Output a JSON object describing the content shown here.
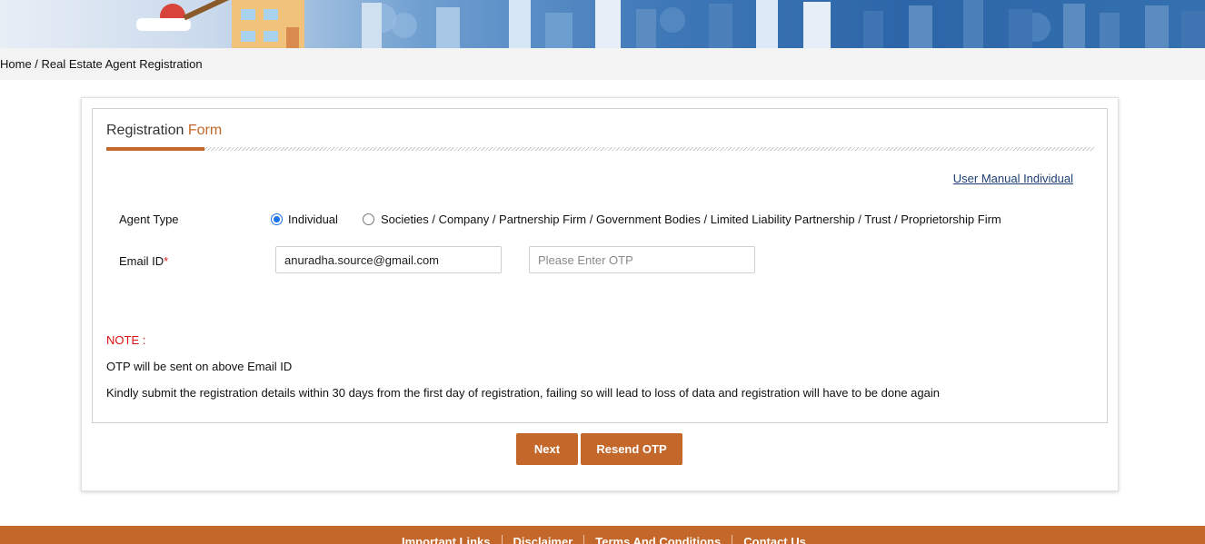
{
  "breadcrumb": {
    "home": "Home",
    "separator": " / ",
    "current": "Real Estate Agent Registration"
  },
  "form": {
    "title_main": "Registration",
    "title_accent": "Form",
    "manual_link": "User Manual Individual",
    "agent_type_label": "Agent Type",
    "agent_type_options": [
      {
        "label": "Individual",
        "selected": true
      },
      {
        "label": "Societies / Company / Partnership Firm / Government Bodies / Limited Liability Partnership / Trust / Proprietorship Firm",
        "selected": false
      }
    ],
    "email_label": "Email ID",
    "required_mark": "*",
    "email_value": "anuradha.source@gmail.com",
    "otp_placeholder": "Please Enter OTP",
    "note_title": "NOTE :",
    "note_lines": [
      "OTP will be sent on above Email ID",
      "Kindly submit the registration details within 30 days from the first day of registration, failing so will lead to loss of data and registration will have to be done again"
    ]
  },
  "buttons": {
    "next": "Next",
    "resend": "Resend OTP"
  },
  "footer": {
    "links": [
      "Important Links",
      "Disclaimer",
      "Terms And Conditions",
      "Contact Us"
    ]
  },
  "colors": {
    "accent": "#c4672a",
    "link": "#1d3f72",
    "note": "#d11111",
    "radio": "#1a73e8"
  }
}
